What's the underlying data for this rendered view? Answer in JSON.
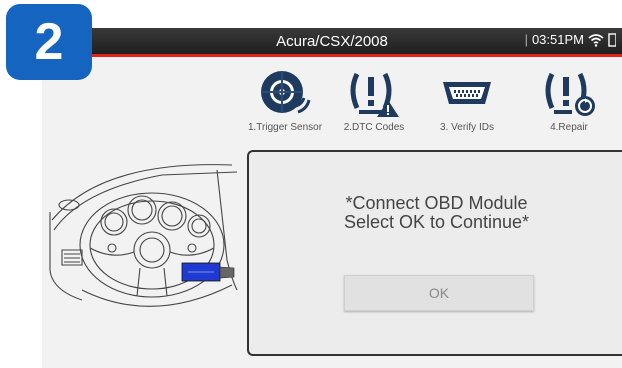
{
  "step_badge": "2",
  "header": {
    "title": "Acura/CSX/2008",
    "time": "03:51PM"
  },
  "menu": [
    {
      "label": "1.Trigger Sensor",
      "icon": "tire-sensor-icon"
    },
    {
      "label": "2.DTC Codes",
      "icon": "tpms-warning-icon"
    },
    {
      "label": "3. Verify IDs",
      "icon": "obd-connector-icon"
    },
    {
      "label": "4.Repair",
      "icon": "tpms-repair-icon"
    }
  ],
  "dialog": {
    "line1": "*Connect OBD Module",
    "line2": "Select OK to Continue*",
    "ok_label": "OK"
  },
  "colors": {
    "brand_blue": "#1565c0",
    "accent_red": "#e2231a",
    "icon_navy": "#1f3a5f"
  }
}
